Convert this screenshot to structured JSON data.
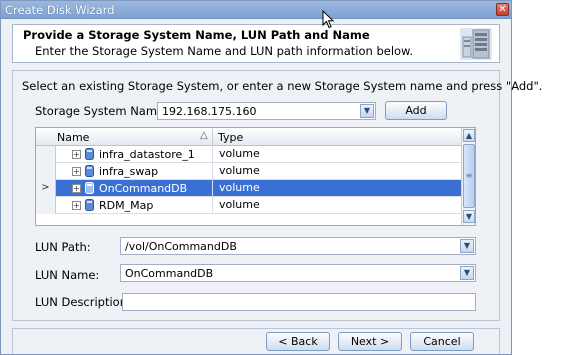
{
  "window": {
    "title": "Create Disk Wizard",
    "close": "✕"
  },
  "header": {
    "title": "Provide a Storage System Name, LUN Path and Name",
    "subtitle": "Enter the Storage System Name and LUN path information below."
  },
  "instruction": "Select an existing Storage System, or enter a new Storage System name and press \"Add\".",
  "storage_system": {
    "label": "Storage System Name:",
    "value": "192.168.175.160",
    "add_label": "Add"
  },
  "grid": {
    "columns": [
      "Name",
      "Type"
    ],
    "sort_indicator": "△",
    "rows": [
      {
        "name": "infra_datastore_1",
        "type": "volume",
        "selected": false
      },
      {
        "name": "infra_swap",
        "type": "volume",
        "selected": false
      },
      {
        "name": "OnCommandDB",
        "type": "volume",
        "selected": true
      },
      {
        "name": "RDM_Map",
        "type": "volume",
        "selected": false
      }
    ],
    "current_row_marker": ">"
  },
  "lun_path": {
    "label": "LUN Path:",
    "value": "/vol/OnCommandDB"
  },
  "lun_name": {
    "label": "LUN Name:",
    "value": "OnCommandDB"
  },
  "lun_description": {
    "label": "LUN Description:",
    "value": ""
  },
  "buttons": {
    "back": "< Back",
    "next": "Next >",
    "cancel": "Cancel"
  },
  "colors": {
    "selection": "#3a6fd3",
    "titlebar": "#8aabd8"
  }
}
